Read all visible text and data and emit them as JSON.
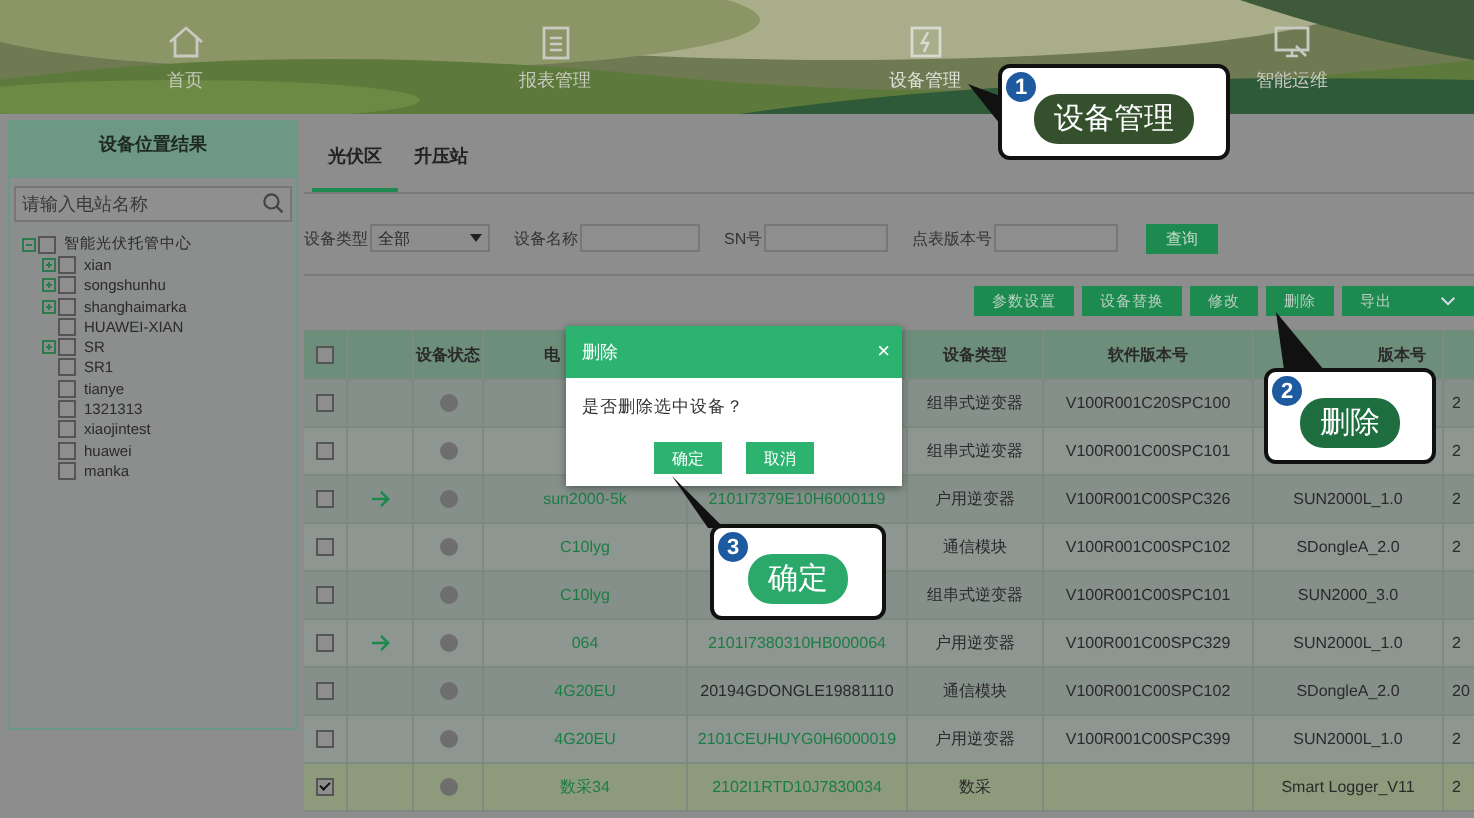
{
  "nav": {
    "items": [
      {
        "label": "首页",
        "selected": false
      },
      {
        "label": "报表管理",
        "selected": false
      },
      {
        "label": "设备管理",
        "selected": true
      },
      {
        "label": "智能运维",
        "selected": false
      }
    ]
  },
  "sidebar": {
    "title": "设备位置结果",
    "search": {
      "placeholder": "请输入电站名称"
    },
    "tree": [
      {
        "label": "智能光伏托管中心",
        "expanded": true,
        "checked": false,
        "children": [
          {
            "label": "xian",
            "expandable": true,
            "checked": false
          },
          {
            "label": "songshunhu",
            "expandable": true,
            "checked": false
          },
          {
            "label": "shanghaimarka",
            "expandable": true,
            "checked": false
          },
          {
            "label": "HUAWEI-XIAN",
            "expandable": false,
            "checked": false
          },
          {
            "label": "SR",
            "expandable": true,
            "checked": false
          },
          {
            "label": "SR1",
            "expandable": false,
            "checked": false
          },
          {
            "label": "tianye",
            "expandable": false,
            "checked": false
          },
          {
            "label": "1321313",
            "expandable": false,
            "checked": false
          },
          {
            "label": "xiaojintest",
            "expandable": false,
            "checked": false
          },
          {
            "label": "huawei",
            "expandable": false,
            "checked": false
          },
          {
            "label": "manka",
            "expandable": false,
            "checked": false
          }
        ]
      }
    ]
  },
  "tabs": [
    {
      "label": "光伏区",
      "selected": true
    },
    {
      "label": "升压站",
      "selected": false
    }
  ],
  "filters": [
    {
      "label": "设备类型",
      "kind": "select",
      "value": "全部"
    },
    {
      "label": "设备名称",
      "kind": "text"
    },
    {
      "label": "SN号",
      "kind": "text"
    },
    {
      "label": "点表版本号",
      "kind": "text"
    }
  ],
  "query_button": "查询",
  "actions": [
    {
      "label": "参数设置",
      "dropdown": false
    },
    {
      "label": "设备替换",
      "dropdown": false
    },
    {
      "label": "修改",
      "dropdown": false
    },
    {
      "label": "删除",
      "dropdown": false
    },
    {
      "label": "导出",
      "dropdown": true
    }
  ],
  "table": {
    "select_all": {
      "checked": false
    },
    "columns": {
      "status": "设备状态",
      "column_4": "电",
      "type": "设备类型",
      "software": "软件版本号",
      "column_8": "版本号"
    },
    "rows": [
      {
        "checked": false,
        "arrow": false,
        "type": "组串式逆变器",
        "software": "V100R001C20SPC100",
        "column_9": "2"
      },
      {
        "checked": false,
        "arrow": false,
        "type": "组串式逆变器",
        "software": "V100R001C00SPC101",
        "column_9": "2"
      },
      {
        "checked": false,
        "arrow": true,
        "name": "sun2000-5k",
        "sn": "2101I7379E10H6000119",
        "sn_linked": true,
        "type": "户用逆变器",
        "software": "V100R001C00SPC326",
        "column_8": "SUN2000L_1.0",
        "column_9": "2"
      },
      {
        "checked": false,
        "arrow": false,
        "name": "C10lyg",
        "type": "通信模块",
        "software": "V100R001C00SPC102",
        "column_8": "SDongleA_2.0",
        "column_9": "2"
      },
      {
        "checked": false,
        "arrow": false,
        "name": "C10lyg",
        "type": "组串式逆变器",
        "software": "V100R001C00SPC101",
        "column_8": "SUN2000_3.0"
      },
      {
        "checked": false,
        "arrow": true,
        "name": "064",
        "sn": "2101I7380310HB000064",
        "sn_linked": true,
        "type": "户用逆变器",
        "software": "V100R001C00SPC329",
        "column_8": "SUN2000L_1.0",
        "column_9": "2"
      },
      {
        "checked": false,
        "arrow": false,
        "name": "4G20EU",
        "sn": "20194GDONGLE19881110",
        "sn_linked": false,
        "type": "通信模块",
        "software": "V100R001C00SPC102",
        "column_8": "SDongleA_2.0",
        "column_9": "20"
      },
      {
        "checked": false,
        "arrow": false,
        "name": "4G20EU",
        "sn": "2101CEUHUYG0H6000019",
        "sn_linked": true,
        "type": "户用逆变器",
        "software": "V100R001C00SPC399",
        "column_8": "SUN2000L_1.0",
        "column_9": "2"
      },
      {
        "checked": true,
        "arrow": false,
        "name": "数采34",
        "sn": "2102I1RTD10J7830034",
        "sn_linked": true,
        "type": "数采",
        "column_8": "Smart Logger_V11",
        "column_9": "2"
      }
    ]
  },
  "dialog": {
    "title": "删除",
    "close": "×",
    "message": "是否删除选中设备？",
    "buttons": [
      "确定",
      "取消"
    ]
  },
  "callouts": [
    {
      "number": "1",
      "label": "设备管理",
      "color": "#34502c"
    },
    {
      "number": "2",
      "label": "删除",
      "color": "#1f6e40"
    },
    {
      "number": "3",
      "label": "确定",
      "color": "#2aa96a"
    }
  ]
}
